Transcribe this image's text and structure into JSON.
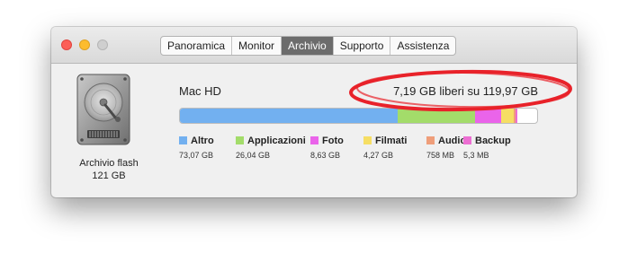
{
  "window": {
    "tabs": [
      {
        "label": "Panoramica",
        "active": false
      },
      {
        "label": "Monitor",
        "active": false
      },
      {
        "label": "Archivio",
        "active": true
      },
      {
        "label": "Supporto",
        "active": false
      },
      {
        "label": "Assistenza",
        "active": false
      }
    ]
  },
  "drive": {
    "icon": "hard-drive-icon",
    "label_line1": "Archivio flash",
    "label_line2": "121 GB"
  },
  "volume": {
    "name": "Mac HD",
    "free_text": "7,19 GB liberi su 119,97 GB",
    "free_gb": 7.19,
    "total_gb": 119.97
  },
  "storage_categories": [
    {
      "name": "Altro",
      "size": "73,07 GB",
      "size_gb": 73.07,
      "color": "#72b0f0"
    },
    {
      "name": "Applicazioni",
      "size": "26,04 GB",
      "size_gb": 26.04,
      "color": "#a3dc6a"
    },
    {
      "name": "Foto",
      "size": "8,63 GB",
      "size_gb": 8.63,
      "color": "#ea64ea"
    },
    {
      "name": "Filmati",
      "size": "4,27 GB",
      "size_gb": 4.27,
      "color": "#f6de64"
    },
    {
      "name": "Audio",
      "size": "758 MB",
      "size_gb": 0.758,
      "color": "#ef9e7a"
    },
    {
      "name": "Backup",
      "size": "5,3 MB",
      "size_gb": 0.0053,
      "color": "#ec6ed2"
    }
  ],
  "annotation": {
    "color": "#e8222a"
  }
}
